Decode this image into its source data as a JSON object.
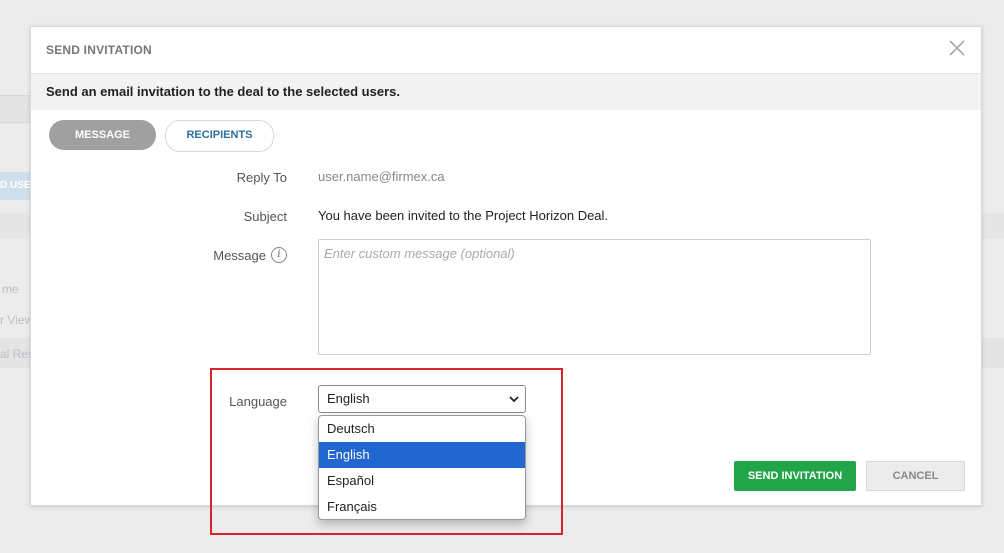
{
  "background": {
    "fragments": [
      "D USE",
      "me",
      "r View",
      "al Res"
    ]
  },
  "modal": {
    "title": "SEND INVITATION",
    "notice": "Send an email invitation to the deal to the selected users.",
    "tabs": [
      {
        "label": "MESSAGE",
        "active": true
      },
      {
        "label": "RECIPIENTS",
        "active": false
      }
    ],
    "form": {
      "reply_to_label": "Reply To",
      "reply_to_value": "user.name@firmex.ca",
      "subject_label": "Subject",
      "subject_value": "You have been invited to the Project Horizon Deal.",
      "message_label": "Message",
      "message_placeholder": "Enter custom message (optional)",
      "message_value": "",
      "info_glyph": "i",
      "language_label": "Language",
      "language_selected": "English",
      "language_options": [
        "Deutsch",
        "English",
        "Español",
        "Français"
      ]
    },
    "buttons": {
      "send": "SEND INVITATION",
      "cancel": "CANCEL"
    }
  },
  "colors": {
    "send": "#22a548",
    "selected_option": "#2167cf",
    "highlight": "#d8232a",
    "tab_active": "#a0a0a0",
    "tab_inactive_text": "#2d6ea3"
  }
}
